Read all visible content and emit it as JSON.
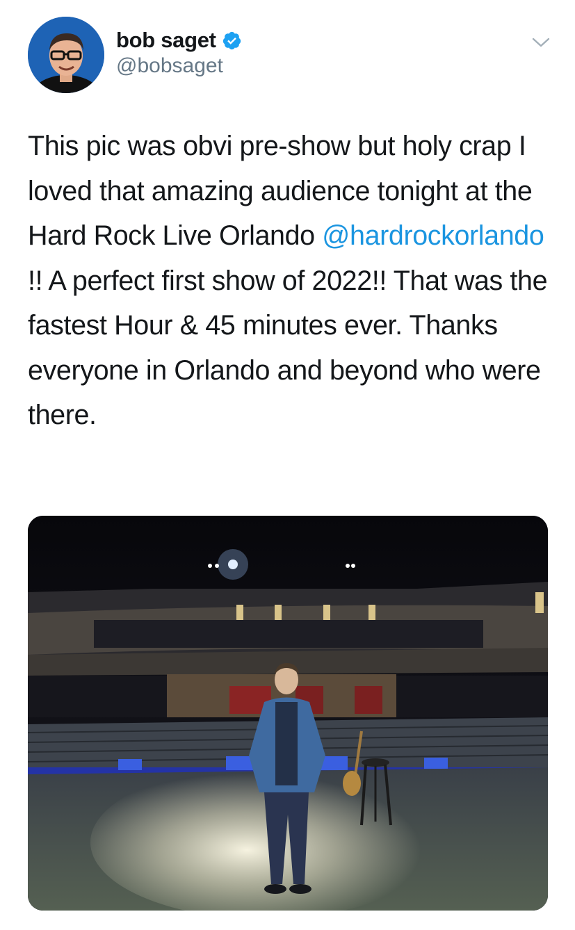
{
  "user": {
    "display_name": "bob saget",
    "handle": "@bobsaget",
    "verified": true,
    "verified_color": "#1da1f2",
    "avatar_icon": "profile-photo"
  },
  "header": {
    "menu_icon": "chevron-down-icon"
  },
  "tweet": {
    "text_part1": "This pic was obvi pre-show but holy crap I loved that amazing audience tonight at the Hard Rock Live Orlando ",
    "mention": "@hardrockorlando",
    "text_part2": " !! A perfect first show of 2022!! That was the fastest Hour & 45 minutes ever. Thanks everyone in Orlando and beyond who were there.",
    "mention_color": "#1b95e0"
  },
  "media": {
    "type": "photo",
    "icon": "photo-image"
  }
}
